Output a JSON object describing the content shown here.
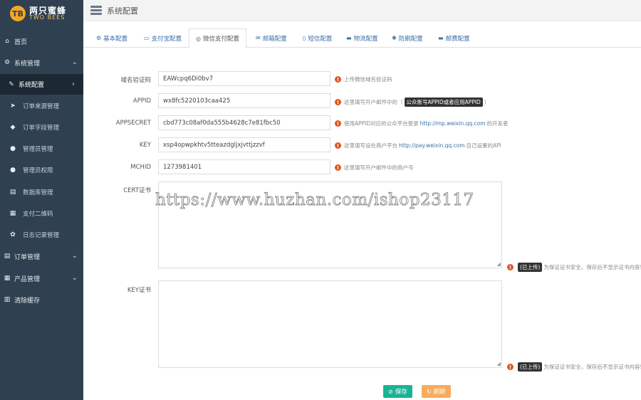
{
  "logo": {
    "badge": "ТВ",
    "cn": "两只蜜蜂",
    "en": "TWO BEES"
  },
  "header": {
    "title": "系统配置"
  },
  "sidebar": {
    "items": [
      {
        "label": "首页",
        "icon": "home-icon",
        "glyph": "⌂"
      },
      {
        "label": "系统管理",
        "icon": "gear-icon",
        "glyph": "⚙"
      },
      {
        "label": "系统配置",
        "icon": "wrench-icon",
        "glyph": "✎"
      },
      {
        "label": "订单来源管理",
        "icon": "send-icon",
        "glyph": "➤"
      },
      {
        "label": "订单字段管理",
        "icon": "tag-icon",
        "glyph": "◆"
      },
      {
        "label": "管理员管理",
        "icon": "user-icon",
        "glyph": "●"
      },
      {
        "label": "管理员权限",
        "icon": "users-icon",
        "glyph": "●"
      },
      {
        "label": "数据库管理",
        "icon": "database-icon",
        "glyph": "▤"
      },
      {
        "label": "支付二维码",
        "icon": "qrcode-icon",
        "glyph": "▦"
      },
      {
        "label": "日志记录管理",
        "icon": "paw-icon",
        "glyph": "✿"
      },
      {
        "label": "订单管理",
        "icon": "list-icon",
        "glyph": "▤"
      },
      {
        "label": "产品管理",
        "icon": "grid-icon",
        "glyph": "▦"
      },
      {
        "label": "清除缓存",
        "icon": "trash-icon",
        "glyph": "▥"
      }
    ]
  },
  "tabs": [
    {
      "label": "基本配置",
      "glyph": "⚙"
    },
    {
      "label": "支付宝配置",
      "glyph": "▭"
    },
    {
      "label": "微信支付配置",
      "glyph": "◎"
    },
    {
      "label": "邮箱配置",
      "glyph": "✉"
    },
    {
      "label": "短信配置",
      "glyph": "▯"
    },
    {
      "label": "物流配置",
      "glyph": "▬"
    },
    {
      "label": "防刷配置",
      "glyph": "✺"
    },
    {
      "label": "邮费配置",
      "glyph": "▬"
    }
  ],
  "form": {
    "verify": {
      "label": "域名验证码",
      "value": "EAWcpq6Di0bv7",
      "hint": "上传微信域名验证码"
    },
    "appid": {
      "label": "APPID",
      "value": "wx8fc5220103caa425",
      "hint_pre": "这里填写开户邮件中的（",
      "hint_tag": "公众账号APPID或者应用APPID",
      "hint_post": "）"
    },
    "appsecret": {
      "label": "APPSECRET",
      "value": "cbd773c08af0da555b4628c7e81fbc50",
      "hint_pre": "使用APPID对应的公众平台登录",
      "hint_link": "http://mp.weixin.qq.com",
      "hint_post": "的开发者"
    },
    "key": {
      "label": "KEY",
      "value": "xsp4opwpkhtv5tteazdgljxjvttjzzvf",
      "hint_pre": "这里填写设在商户平台",
      "hint_link": "http://pay.weixin.qq.com",
      "hint_post": "自己设置的API"
    },
    "mchid": {
      "label": "MCHID",
      "value": "1273981401",
      "hint": "这里填写开户邮件中的商户号"
    },
    "cert": {
      "label": "CERT证书",
      "tag": "(已上传)",
      "hint": "为保证证书安全，保存后不显示证书内容!"
    },
    "keycert": {
      "label": "KEY证书",
      "tag": "(已上传)",
      "hint": "为保证证书安全，保存后不显示证书内容!"
    }
  },
  "watermark": "https://www.huzhan.com/ishop23117",
  "buttons": {
    "save": "保存",
    "refresh": "刷新"
  }
}
